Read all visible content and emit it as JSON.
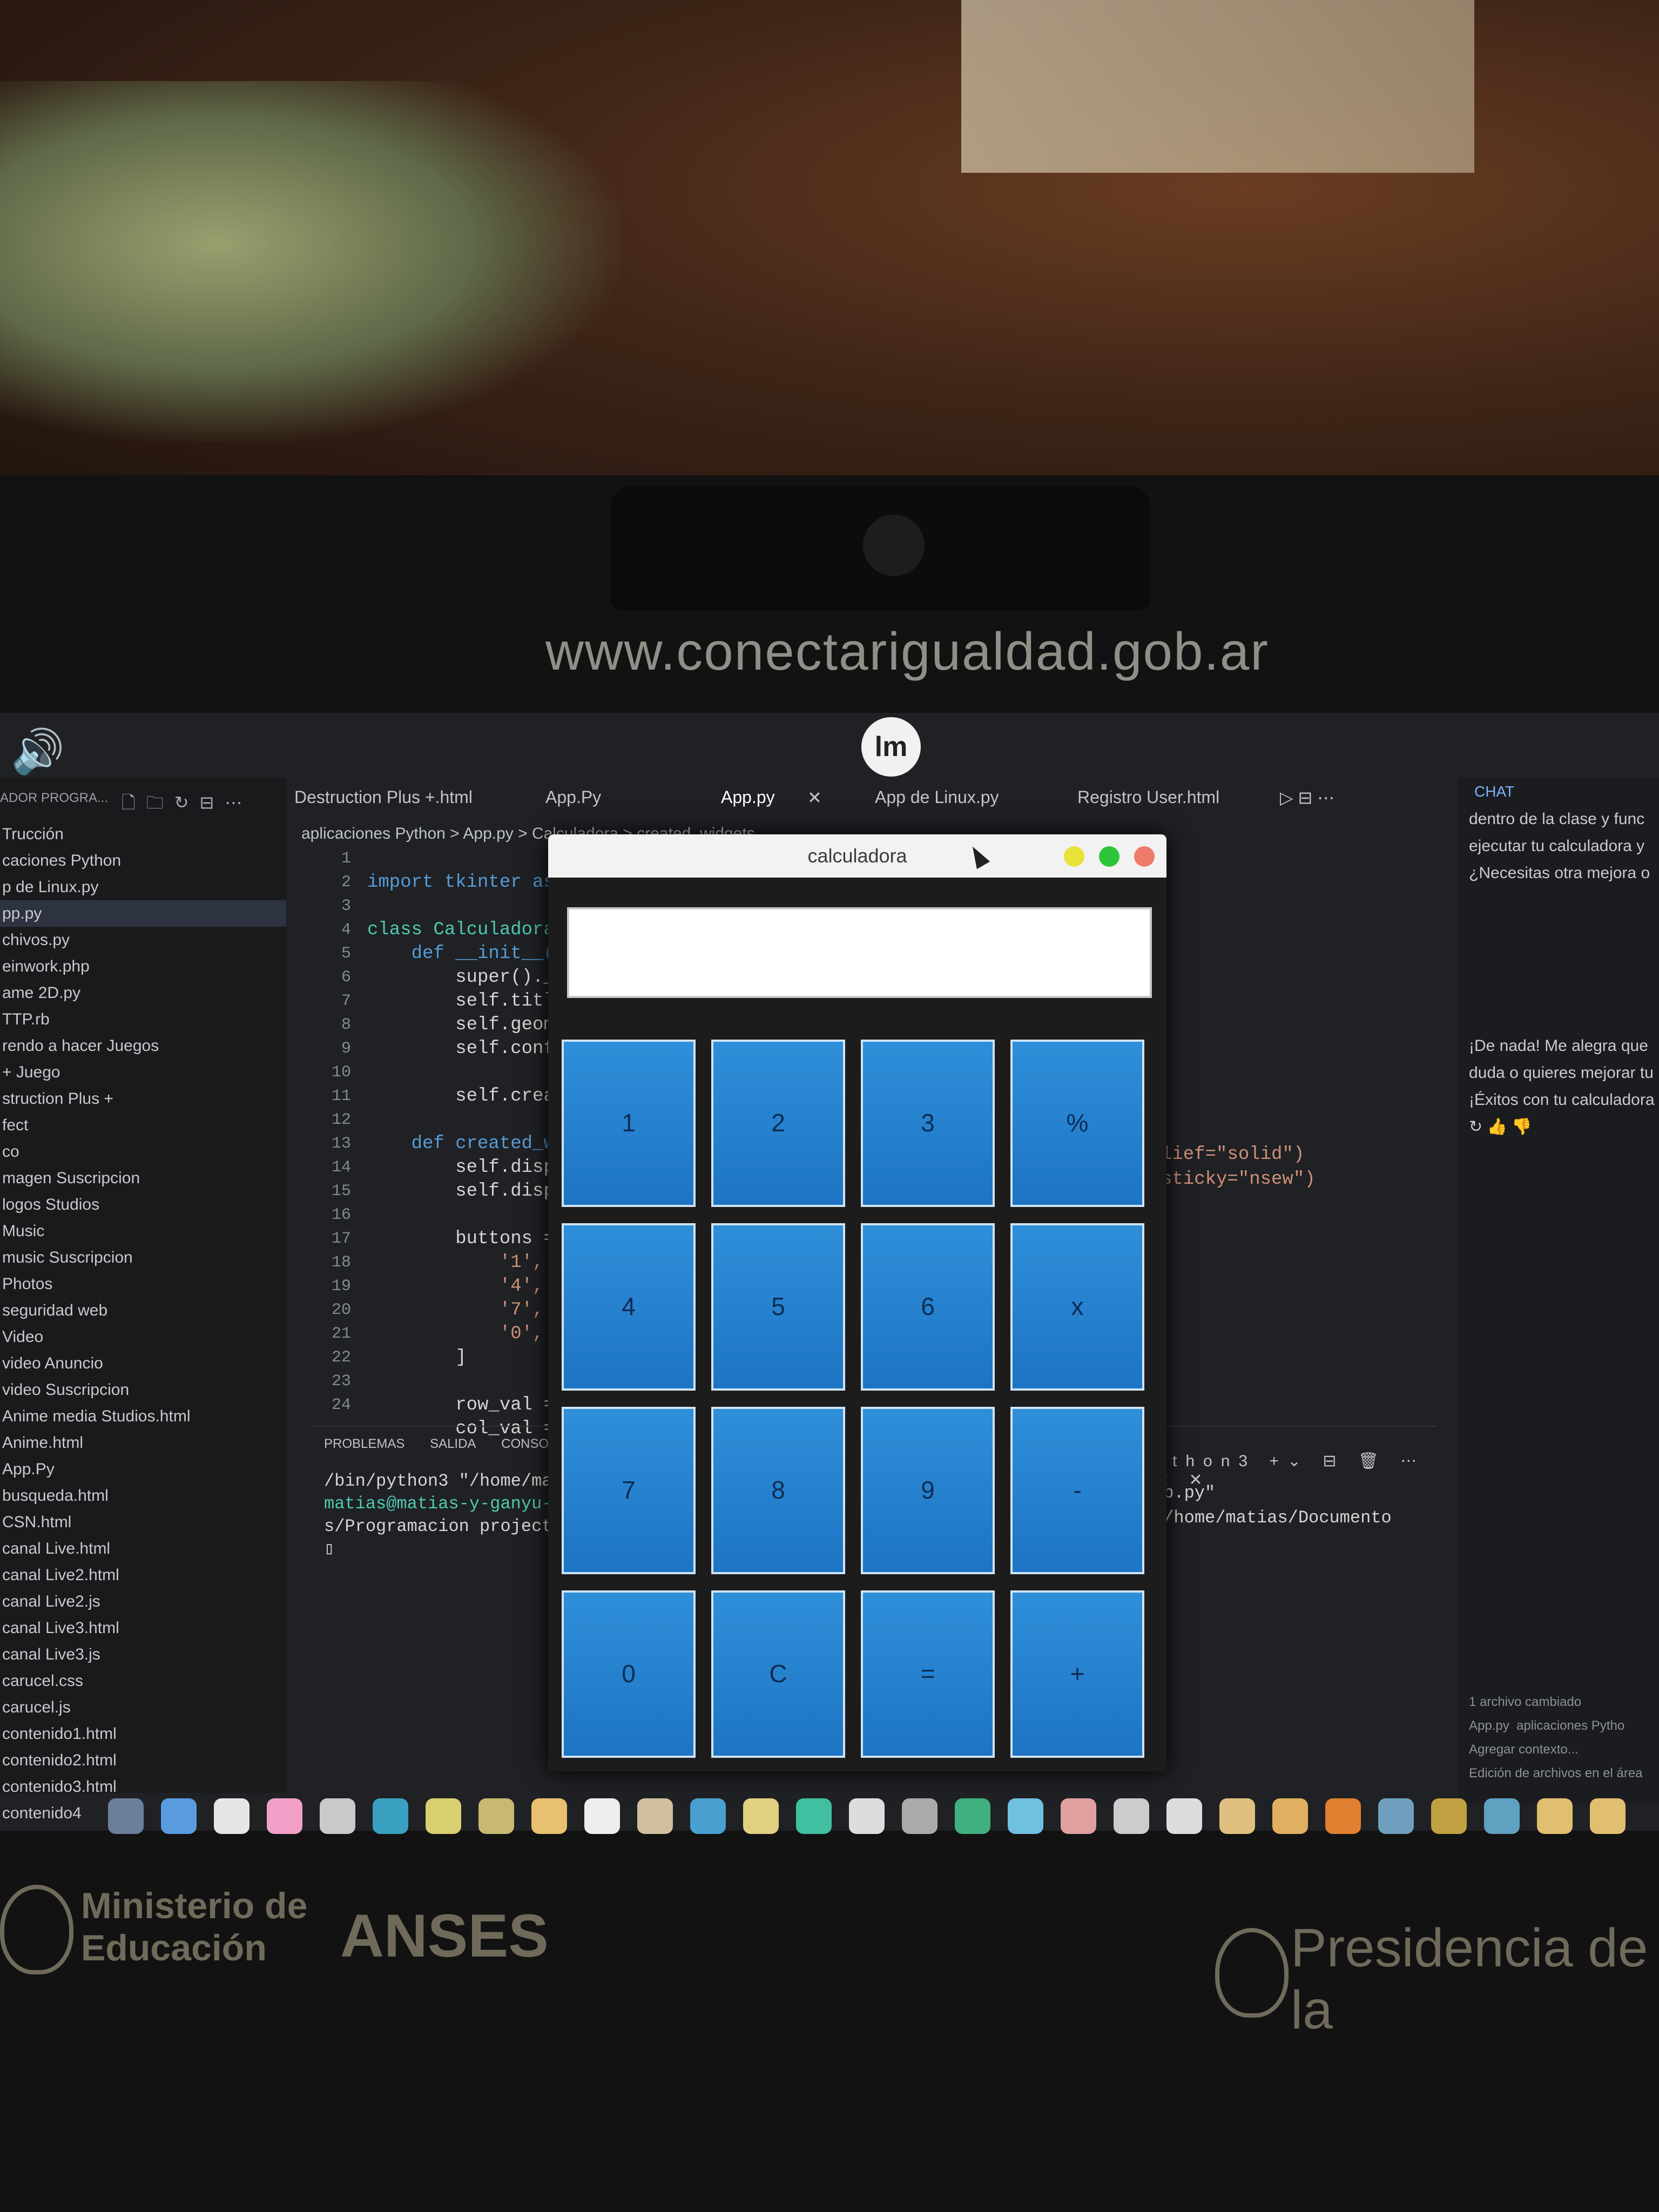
{
  "site_text": "www.conectarigualdad.gob.ar",
  "bottom_logos": {
    "ministerio": "Ministerio de",
    "educacion": "Educación",
    "anses": "ANSES",
    "presidencia": "Presidencia de la"
  },
  "sidebar": {
    "header": "ADOR PROGRA...",
    "items": [
      "Trucción",
      "caciones Python",
      "p de Linux.py",
      "pp.py",
      "chivos.py",
      "einwork.php",
      "ame 2D.py",
      "TTP.rb",
      "rendo a hacer Juegos",
      "+ Juego",
      "struction Plus +",
      "fect",
      "co",
      "magen Suscripcion",
      "logos Studios",
      "Music",
      "music Suscripcion",
      "Photos",
      "seguridad web",
      "Video",
      "video Anuncio",
      "video Suscripcion",
      "Anime media Studios.html",
      "Anime.html",
      "App.Py",
      "busqueda.html",
      "CSN.html",
      "canal Live.html",
      "canal Live2.html",
      "canal Live2.js",
      "canal Live3.html",
      "canal Live3.js",
      "carucel.css",
      "carucel.js",
      "contenido1.html",
      "contenido2.html",
      "contenido3.html",
      "contenido4"
    ]
  },
  "tabs": [
    "Destruction Plus +.html",
    "App.Py",
    "App.py",
    "App de Linux.py",
    "Registro User.html"
  ],
  "tab_close": "✕",
  "breadcrumb": "aplicaciones Python > App.py > Calculadora > created_widgets",
  "gutter": "1\n2\n3\n4\n5\n6\n7\n8\n9\n10\n11\n12\n13\n14\n15\n16\n17\n18\n19\n20\n21\n22\n23\n24",
  "code": {
    "l1": "import tkinter as",
    "l3": "class Calculadora",
    "l4": "    def __init__(",
    "l5": "        super()._",
    "l6": "        self.titl",
    "l7": "        self.geom",
    "l8": "        self.conf",
    "l10": "        self.crea",
    "l12": "    def created_w",
    "l13": "        self.disp",
    "l14": "        self.disp",
    "l16": "        buttons =",
    "l17": "            '1',",
    "l18": "            '4',",
    "l19": "            '7',",
    "l20": "            '0',",
    "l21": "        ]",
    "l23": "        row_val =",
    "l24": "        col_val ="
  },
  "code_right": "lief=\"solid\")\nsticky=\"nsew\")",
  "panel": {
    "tabs": [
      "PROBLEMAS",
      "SALIDA",
      "CONSOLA"
    ],
    "term_l1": "/bin/python3 \"/home/mat",
    "term_l2": "matias@matias-y-ganyu-S",
    "term_l3": "s/Programacion project/",
    "term_right": "pp.py\"\n\"/home/matias/Documento",
    "tool_label": "ython3"
  },
  "chat": {
    "header": "CHAT",
    "msg1": "dentro de la clase y func\nejecutar tu calculadora y\n¿Necesitas otra mejora o",
    "msg2": "¡De nada! Me alegra que\nduda o quieres mejorar tu\n¡Éxitos con tu calculadora",
    "footer": "1 archivo cambiado\nApp.py  aplicaciones Pytho\nAgregar contexto...\nEdición de archivos en el área"
  },
  "calculator": {
    "title": "calculadora",
    "display_value": "",
    "keys": [
      "1",
      "2",
      "3",
      "%",
      "4",
      "5",
      "6",
      "x",
      "7",
      "8",
      "9",
      "-",
      "0",
      "C",
      "=",
      "+"
    ]
  },
  "colors": {
    "key_blue": "#1d74c4",
    "titlebar": "#f2f2f2",
    "min": "#e8e23a",
    "max": "#2ec43a",
    "close": "#f07a6a"
  }
}
